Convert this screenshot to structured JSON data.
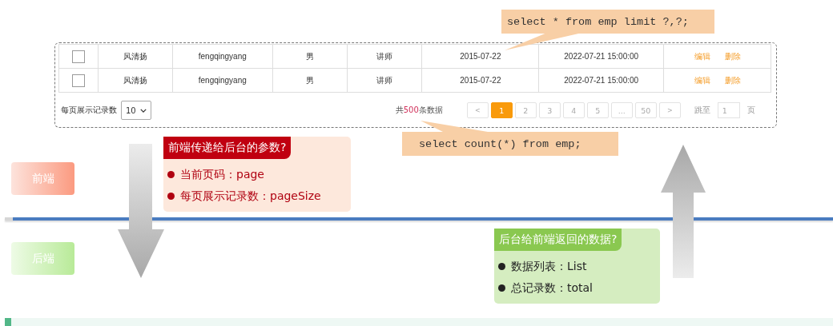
{
  "table": {
    "rows": [
      {
        "checked": false,
        "cells": [
          "风清扬",
          "fengqingyang",
          "男",
          "讲师",
          "2015-07-22",
          "2022-07-21 15:00:00"
        ],
        "actions": [
          "编辑",
          "删除"
        ]
      },
      {
        "checked": false,
        "cells": [
          "风清扬",
          "fengqingyang",
          "男",
          "讲师",
          "2015-07-22",
          "2022-07-21 15:00:00"
        ],
        "actions": [
          "编辑",
          "删除"
        ]
      }
    ]
  },
  "footer": {
    "page_size_label": "每页展示记录数",
    "page_size": "10",
    "total": {
      "prefix": "共",
      "count": "500",
      "suffix": "条数据"
    },
    "pages": [
      {
        "label": "<",
        "kind": "arrow",
        "selected": false
      },
      {
        "label": "1",
        "kind": "page",
        "selected": true
      },
      {
        "label": "2",
        "kind": "page",
        "selected": false
      },
      {
        "label": "3",
        "kind": "page",
        "selected": false
      },
      {
        "label": "4",
        "kind": "page",
        "selected": false
      },
      {
        "label": "5",
        "kind": "page",
        "selected": false
      },
      {
        "label": "...",
        "kind": "page",
        "selected": false
      },
      {
        "label": "50",
        "kind": "page",
        "selected": false
      },
      {
        "label": ">",
        "kind": "arrow",
        "selected": false
      }
    ],
    "jump_label": "跳至",
    "jump_value": "1",
    "page_unit": "页"
  },
  "sql_callouts": [
    {
      "text": "select * from emp limit ?,?;",
      "kind": "top"
    },
    {
      "text": "select count(*) from emp;",
      "kind": "bottom"
    }
  ],
  "layers": [
    {
      "label": "前端",
      "kind": "front"
    },
    {
      "label": "后端",
      "kind": "back"
    }
  ],
  "request_box": {
    "title": "前端传递给后台的参数?",
    "items": [
      "当前页码：page",
      "每页展示记录数：pageSize"
    ]
  },
  "response_box": {
    "title": "后台给前端返回的数据?",
    "items": [
      "数据列表：List",
      "总记录数：total"
    ]
  }
}
